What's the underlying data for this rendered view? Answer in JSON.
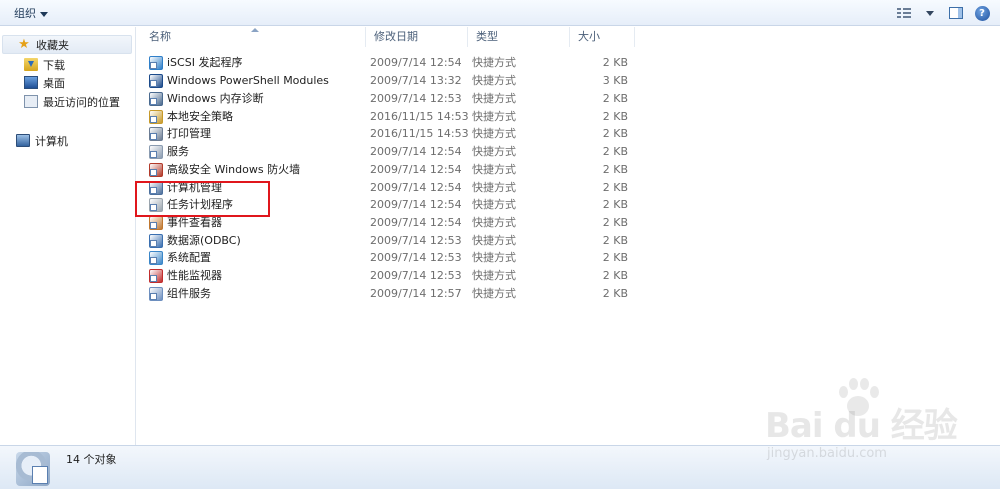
{
  "toolbar": {
    "organize_label": "组织"
  },
  "nav": {
    "favorites_label": "收藏夹",
    "items": [
      {
        "label": "下载",
        "icon": "download-folder-icon"
      },
      {
        "label": "桌面",
        "icon": "desktop-icon"
      },
      {
        "label": "最近访问的位置",
        "icon": "recent-places-icon"
      }
    ],
    "computer_label": "计算机"
  },
  "columns": {
    "name": "名称",
    "date": "修改日期",
    "type": "类型",
    "size": "大小"
  },
  "files": [
    {
      "name": "iSCSI 发起程序",
      "date": "2009/7/14 12:54",
      "type": "快捷方式",
      "size": "2 KB",
      "icon": "iscsi-icon",
      "color": "#2f7fc9"
    },
    {
      "name": "Windows PowerShell Modules",
      "date": "2009/7/14 13:32",
      "type": "快捷方式",
      "size": "3 KB",
      "icon": "powershell-icon",
      "color": "#1b4a8a"
    },
    {
      "name": "Windows 内存诊断",
      "date": "2009/7/14 12:53",
      "type": "快捷方式",
      "size": "2 KB",
      "icon": "memory-diagnostic-icon",
      "color": "#4a6a8f"
    },
    {
      "name": "本地安全策略",
      "date": "2016/11/15 14:53",
      "type": "快捷方式",
      "size": "2 KB",
      "icon": "security-policy-icon",
      "color": "#c79a2a"
    },
    {
      "name": "打印管理",
      "date": "2016/11/15 14:53",
      "type": "快捷方式",
      "size": "2 KB",
      "icon": "print-management-icon",
      "color": "#6b7c93"
    },
    {
      "name": "服务",
      "date": "2009/7/14 12:54",
      "type": "快捷方式",
      "size": "2 KB",
      "icon": "services-icon",
      "color": "#8a9bb0"
    },
    {
      "name": "高级安全 Windows 防火墙",
      "date": "2009/7/14 12:54",
      "type": "快捷方式",
      "size": "2 KB",
      "icon": "firewall-icon",
      "color": "#b23a2a"
    },
    {
      "name": "计算机管理",
      "date": "2009/7/14 12:54",
      "type": "快捷方式",
      "size": "2 KB",
      "icon": "computer-management-icon",
      "color": "#4c6f9c"
    },
    {
      "name": "任务计划程序",
      "date": "2009/7/14 12:54",
      "type": "快捷方式",
      "size": "2 KB",
      "icon": "task-scheduler-icon",
      "color": "#9aa4ad"
    },
    {
      "name": "事件查看器",
      "date": "2009/7/14 12:54",
      "type": "快捷方式",
      "size": "2 KB",
      "icon": "event-viewer-icon",
      "color": "#c0772f"
    },
    {
      "name": "数据源(ODBC)",
      "date": "2009/7/14 12:53",
      "type": "快捷方式",
      "size": "2 KB",
      "icon": "odbc-icon",
      "color": "#3a6fb0"
    },
    {
      "name": "系统配置",
      "date": "2009/7/14 12:53",
      "type": "快捷方式",
      "size": "2 KB",
      "icon": "system-config-icon",
      "color": "#3a86c8"
    },
    {
      "name": "性能监视器",
      "date": "2009/7/14 12:53",
      "type": "快捷方式",
      "size": "2 KB",
      "icon": "performance-monitor-icon",
      "color": "#c12d2d"
    },
    {
      "name": "组件服务",
      "date": "2009/7/14 12:57",
      "type": "快捷方式",
      "size": "2 KB",
      "icon": "component-services-icon",
      "color": "#6d8fbf"
    }
  ],
  "status": {
    "count_text": "14 个对象"
  },
  "watermark": {
    "logo": "Bai du 经验",
    "url": "jingyan.baidu.com"
  },
  "colors": {
    "highlight": "#e0161c",
    "toolbar_text": "#1e3958"
  }
}
